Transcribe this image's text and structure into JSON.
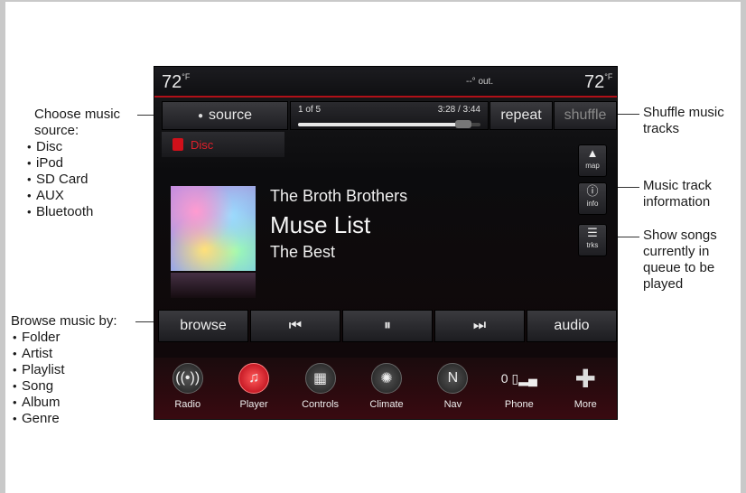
{
  "status": {
    "temp_left": "72",
    "temp_right": "72",
    "temp_unit": "°F",
    "outside": "--° out."
  },
  "player": {
    "source_label": "source",
    "source_name": "Disc",
    "track_count": "1 of 5",
    "track_time": "3:28 / 3:44",
    "progress": 0.93,
    "repeat_label": "repeat",
    "shuffle_label": "shuffle",
    "artist": "The Broth Brothers",
    "song": "Muse List",
    "album": "The Best"
  },
  "side_buttons": {
    "map": "map",
    "info": "info",
    "trks": "trks"
  },
  "transport": {
    "browse": "browse",
    "prev": "⏮",
    "pause": "⏸",
    "next": "⏭",
    "audio": "audio"
  },
  "dock": [
    {
      "label": "Radio",
      "icon": "radio-icon"
    },
    {
      "label": "Player",
      "icon": "player-icon"
    },
    {
      "label": "Controls",
      "icon": "controls-icon"
    },
    {
      "label": "Climate",
      "icon": "climate-icon"
    },
    {
      "label": "Nav",
      "icon": "nav-icon"
    },
    {
      "label": "Phone",
      "icon": "phone-icon"
    },
    {
      "label": "More",
      "icon": "more-icon"
    }
  ],
  "phone_signal": "0",
  "annotations": {
    "source": {
      "title": "Choose music source:",
      "items": [
        "Disc",
        "iPod",
        "SD Card",
        "AUX",
        "Bluetooth"
      ]
    },
    "browse": {
      "title": "Browse music by:",
      "items": [
        "Folder",
        "Artist",
        "Playlist",
        "Song",
        "Album",
        "Genre"
      ]
    },
    "shuffle": "Shuffle music tracks",
    "info": "Music track information",
    "trks": "Show songs currently in queue to be played"
  }
}
